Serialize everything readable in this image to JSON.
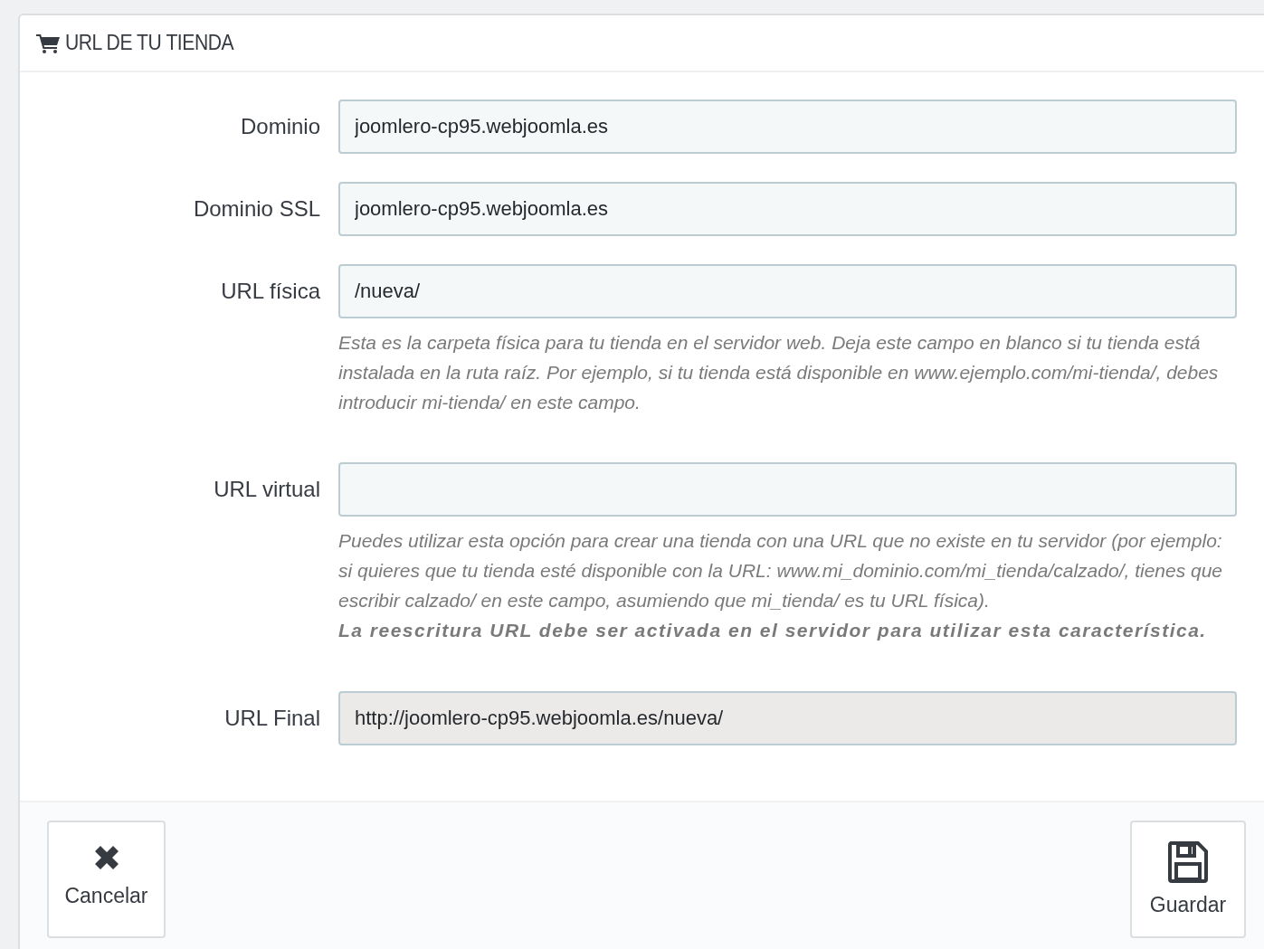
{
  "panel": {
    "title": "URL DE TU TIENDA"
  },
  "fields": [
    {
      "label": "Dominio",
      "value": "joomlero-cp95.webjoomla.es",
      "readonly": false
    },
    {
      "label": "Dominio SSL",
      "value": "joomlero-cp95.webjoomla.es",
      "readonly": false
    },
    {
      "label": "URL física",
      "value": "/nueva/",
      "readonly": false,
      "hint": "Esta es la carpeta física para tu tienda en el servidor web. Deja este campo en blanco si tu tienda está instalada en la ruta raíz. Por ejemplo, si tu tienda está disponible en www.ejemplo.com/mi-tienda/, debes introducir mi-tienda/ en este campo."
    },
    {
      "label": "URL virtual",
      "readonly": false,
      "hint": "Puedes utilizar esta opción para crear una tienda con una URL que no existe en tu servidor (por ejemplo: si quieres que tu tienda esté disponible con la URL: www.mi_dominio.com/mi_tienda/calzado/, tienes que escribir calzado/ en este campo, asumiendo que mi_tienda/ es tu URL física).",
      "note": "La reescritura URL debe ser activada en el servidor para utilizar esta característica."
    },
    {
      "label": "URL Final",
      "value": "http://joomlero-cp95.webjoomla.es/nueva/",
      "readonly": true
    }
  ],
  "footer": {
    "buttons": [
      {
        "label": "Cancelar",
        "kind": "cancel"
      },
      {
        "label": "Guardar",
        "kind": "save"
      }
    ]
  }
}
